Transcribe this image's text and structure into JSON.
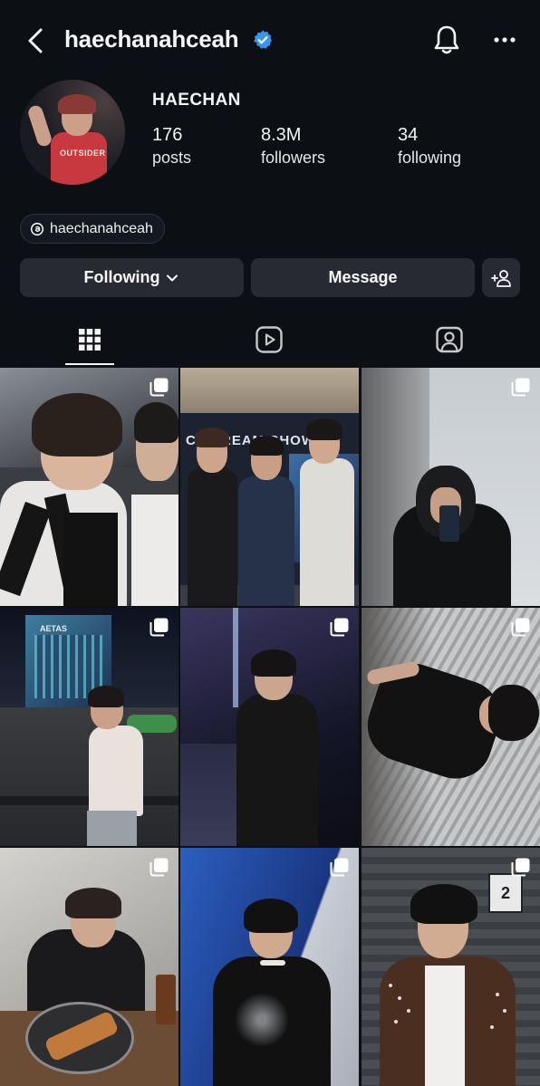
{
  "header": {
    "username": "haechanahceah",
    "verified": true,
    "icons": [
      "back-arrow-icon",
      "verified-badge-icon",
      "bell-icon",
      "more-horizontal-icon"
    ]
  },
  "profile": {
    "display_name": "HAECHAN",
    "avatar_shirt_text": "OUTSIDER",
    "stats": {
      "posts_count": "176",
      "posts_label": "posts",
      "followers_count": "8.3M",
      "followers_label": "followers",
      "following_count": "34",
      "following_label": "following"
    },
    "threads_handle": "haechanahceah"
  },
  "actions": {
    "following_label": "Following",
    "message_label": "Message"
  },
  "tabs": [
    {
      "icon": "grid-icon",
      "active": true
    },
    {
      "icon": "reels-icon",
      "active": false
    },
    {
      "icon": "tagged-icon",
      "active": false
    }
  ],
  "posts": [
    {
      "multi": true,
      "scene": "two performers with headset mics on stage"
    },
    {
      "multi": false,
      "banner_text": "CT DREAM SHOW",
      "scene": "three people posing in front of banner"
    },
    {
      "multi": true,
      "scene": "mirror selfie in black hoodie"
    },
    {
      "multi": true,
      "building_sign": "AETAS",
      "scene": "night street with building"
    },
    {
      "multi": true,
      "scene": "person in black leather jacket in corridor"
    },
    {
      "multi": true,
      "scene": "person lying down in leather jacket"
    },
    {
      "multi": true,
      "scene": "person eating at a table"
    },
    {
      "multi": true,
      "scene": "person in black jacket with necklace"
    },
    {
      "multi": true,
      "door_number": "2",
      "scene": "person in brown studded jacket with headset mic"
    }
  ],
  "colors": {
    "background": "#0c0f14",
    "button": "#272a31",
    "verified": "#3797f0",
    "text": "#f5f5f5"
  }
}
